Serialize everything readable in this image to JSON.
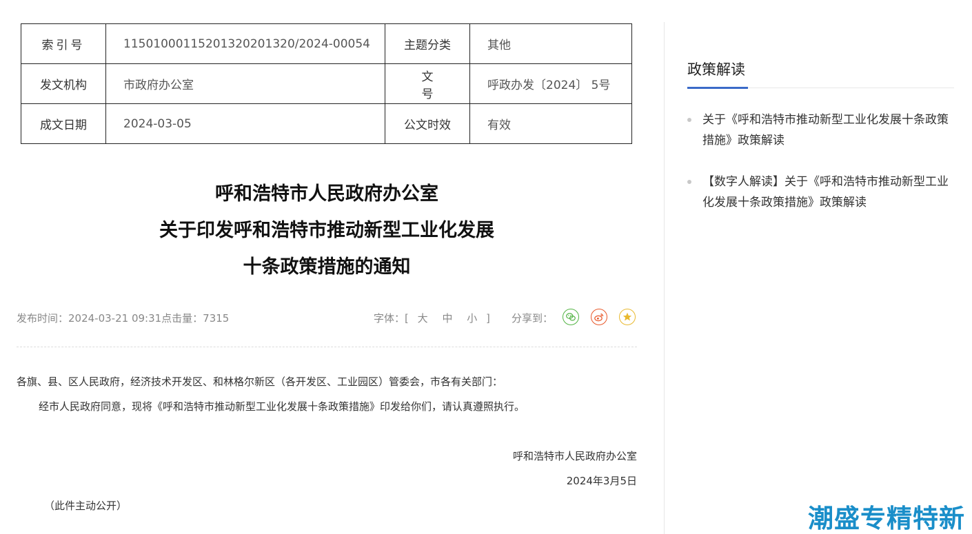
{
  "meta": {
    "rows": [
      {
        "k1": "索引号",
        "v1": "11501000115201320201320/2024-00054",
        "k2": "主题分类",
        "v2": "其他"
      },
      {
        "k1": "发文机构",
        "v1": "市政府办公室",
        "k2": "文号",
        "v2": "呼政办发〔2024〕 5号"
      },
      {
        "k1": "成文日期",
        "v1": "2024-03-05",
        "k2": "公文时效",
        "v2": "有效"
      }
    ]
  },
  "title": {
    "line1": "呼和浩特市人民政府办公室",
    "line2": "关于印发呼和浩特市推动新型工业化发展",
    "line3": "十条政策措施的通知"
  },
  "info": {
    "publish": "发布时间：2024-03-21 09:31点击量：7315",
    "font_label": "字体：[",
    "font_large": "大",
    "font_medium": "中",
    "font_small": "小",
    "font_close": "]",
    "share_label": "分享到："
  },
  "body": {
    "p1": "各旗、县、区人民政府，经济技术开发区、和林格尔新区（各开发区、工业园区）管委会，市各有关部门：",
    "p2": "经市人民政府同意，现将《呼和浩特市推动新型工业化发展十条政策措施》印发给你们，请认真遵照执行。",
    "sign_org": "呼和浩特市人民政府办公室",
    "sign_date": "2024年3月5日",
    "p3": "（此件主动公开）"
  },
  "sidebar": {
    "title": "政策解读",
    "items": [
      {
        "label": "关于《呼和浩特市推动新型工业化发展十条政策措施》政策解读"
      },
      {
        "label": "【数字人解读】关于《呼和浩特市推动新型工业化发展十条政策措施》政策解读"
      }
    ]
  },
  "watermark": "潮盛专精特新",
  "colors": {
    "accent": "#3a6ac8",
    "wechat": "#53b444",
    "weibo": "#e8582a",
    "favorite": "#e9b92f",
    "watermark": "#1a8ec9"
  },
  "icons": [
    "wechat-icon",
    "weibo-icon",
    "star-icon"
  ]
}
